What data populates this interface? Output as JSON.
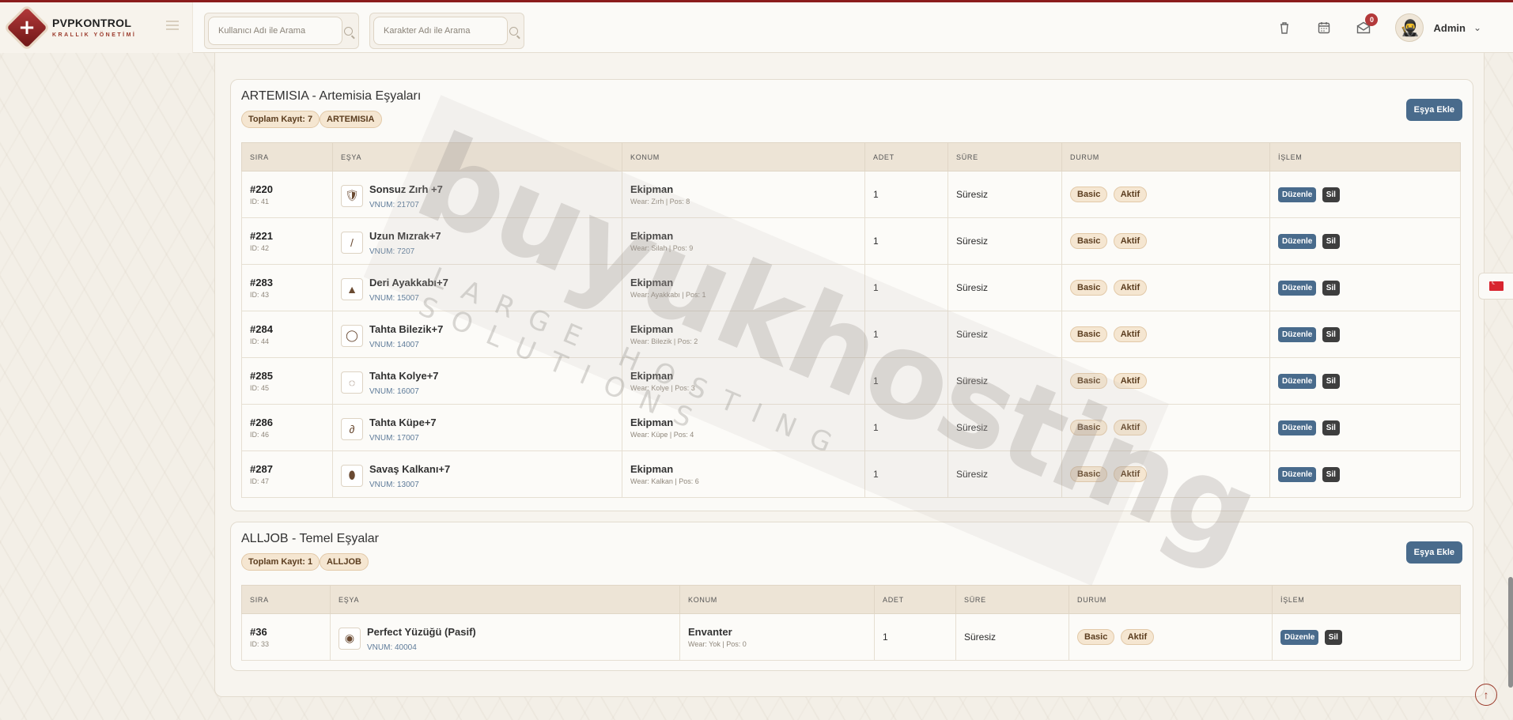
{
  "brand": {
    "title": "PVPKONTROL",
    "subtitle": "KRALLIK YÖNETİMİ"
  },
  "search": {
    "user_placeholder": "Kullanıcı Adı ile Arama",
    "char_placeholder": "Karakter Adı ile Arama"
  },
  "header": {
    "notif_count": "0",
    "admin_name": "Admin",
    "avatar_glyph": "🥷"
  },
  "colors": {
    "accent": "#496b8c",
    "brand": "#8b1c1c",
    "tag_bg": "#f5e6d1"
  },
  "sections": [
    {
      "title": "ARTEMISIA - Artemisia Eşyaları",
      "total": "Toplam Kayıt: 7",
      "code": "ARTEMISIA",
      "add_label": "Eşya Ekle",
      "headers": [
        "SIRA",
        "EŞYA",
        "KONUM",
        "ADET",
        "SÜRE",
        "DURUM",
        "İŞLEM"
      ],
      "rows": [
        {
          "sira": "#220",
          "id": "ID: 41",
          "name": "Sonsuz Zırh +7",
          "vnum": "VNUM: 21707",
          "loc": "Ekipman",
          "loc_sub": "Wear: Zırh | Pos: 8",
          "adet": "1",
          "sure": "Süresiz",
          "t1": "Basic",
          "t2": "Aktif",
          "edit": "Düzenle",
          "del": "Sil",
          "icon": "armor-icon"
        },
        {
          "sira": "#221",
          "id": "ID: 42",
          "name": "Uzun Mızrak+7",
          "vnum": "VNUM: 7207",
          "loc": "Ekipman",
          "loc_sub": "Wear: Silah | Pos: 9",
          "adet": "1",
          "sure": "Süresiz",
          "t1": "Basic",
          "t2": "Aktif",
          "edit": "Düzenle",
          "del": "Sil",
          "icon": "spear-icon"
        },
        {
          "sira": "#283",
          "id": "ID: 43",
          "name": "Deri Ayakkabı+7",
          "vnum": "VNUM: 15007",
          "loc": "Ekipman",
          "loc_sub": "Wear: Ayakkabı | Pos: 1",
          "adet": "1",
          "sure": "Süresiz",
          "t1": "Basic",
          "t2": "Aktif",
          "edit": "Düzenle",
          "del": "Sil",
          "icon": "boots-icon"
        },
        {
          "sira": "#284",
          "id": "ID: 44",
          "name": "Tahta Bilezik+7",
          "vnum": "VNUM: 14007",
          "loc": "Ekipman",
          "loc_sub": "Wear: Bilezik | Pos: 2",
          "adet": "1",
          "sure": "Süresiz",
          "t1": "Basic",
          "t2": "Aktif",
          "edit": "Düzenle",
          "del": "Sil",
          "icon": "bracelet-icon"
        },
        {
          "sira": "#285",
          "id": "ID: 45",
          "name": "Tahta Kolye+7",
          "vnum": "VNUM: 16007",
          "loc": "Ekipman",
          "loc_sub": "Wear: Kolye | Pos: 3",
          "adet": "1",
          "sure": "Süresiz",
          "t1": "Basic",
          "t2": "Aktif",
          "edit": "Düzenle",
          "del": "Sil",
          "icon": "necklace-icon"
        },
        {
          "sira": "#286",
          "id": "ID: 46",
          "name": "Tahta Küpe+7",
          "vnum": "VNUM: 17007",
          "loc": "Ekipman",
          "loc_sub": "Wear: Küpe | Pos: 4",
          "adet": "1",
          "sure": "Süresiz",
          "t1": "Basic",
          "t2": "Aktif",
          "edit": "Düzenle",
          "del": "Sil",
          "icon": "earring-icon"
        },
        {
          "sira": "#287",
          "id": "ID: 47",
          "name": "Savaş Kalkanı+7",
          "vnum": "VNUM: 13007",
          "loc": "Ekipman",
          "loc_sub": "Wear: Kalkan | Pos: 6",
          "adet": "1",
          "sure": "Süresiz",
          "t1": "Basic",
          "t2": "Aktif",
          "edit": "Düzenle",
          "del": "Sil",
          "icon": "shield-icon"
        }
      ]
    },
    {
      "title": "ALLJOB - Temel Eşyalar",
      "total": "Toplam Kayıt: 1",
      "code": "ALLJOB",
      "add_label": "Eşya Ekle",
      "headers": [
        "SIRA",
        "EŞYA",
        "KONUM",
        "ADET",
        "SÜRE",
        "DURUM",
        "İŞLEM"
      ],
      "rows": [
        {
          "sira": "#36",
          "id": "ID: 33",
          "name": "Perfect Yüzüğü (Pasif)",
          "vnum": "VNUM: 40004",
          "loc": "Envanter",
          "loc_sub": "Wear: Yok | Pos: 0",
          "adet": "1",
          "sure": "Süresiz",
          "t1": "Basic",
          "t2": "Aktif",
          "edit": "Düzenle",
          "del": "Sil",
          "icon": "ring-icon"
        }
      ]
    }
  ],
  "peek": {
    "loc": "Ekipman"
  },
  "watermark": {
    "main": "buyukhosting",
    "sub": "LARGE HOSTING SOLUTIONS"
  }
}
